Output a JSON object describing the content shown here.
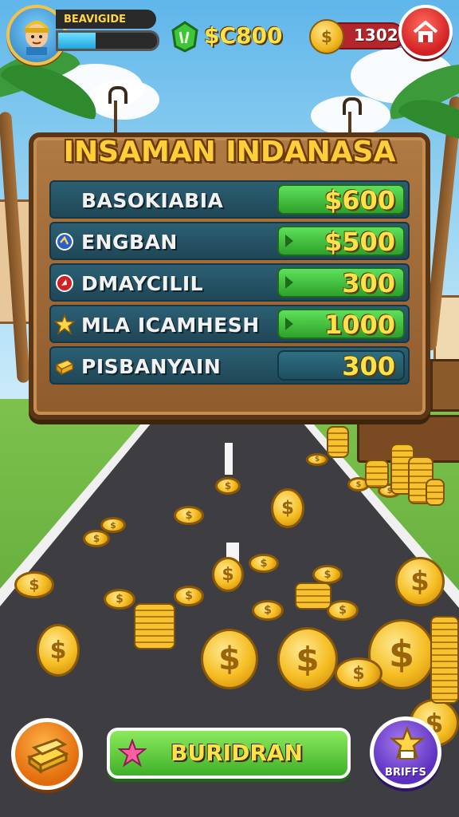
{
  "hud": {
    "player_name": "BEAVIGIDE",
    "xp_progress": 0.38,
    "cash": "$C800",
    "coins": "1302",
    "avatar_icon": "player-avatar-icon",
    "home_icon": "home-icon",
    "gem_icon": "green-gem-icon"
  },
  "shop": {
    "title": "INSAMAN INDANASA",
    "items": [
      {
        "label": "BASOKIABIA",
        "price": "$600",
        "icon": "none",
        "style": "green"
      },
      {
        "label": "ENGBAN",
        "price": "$500",
        "icon": "blue-emblem-icon",
        "style": "green"
      },
      {
        "label": "DMAYCILIL",
        "price": "300",
        "icon": "red-emblem-icon",
        "style": "green"
      },
      {
        "label": "MLA ICAMHESH",
        "price": "1000",
        "icon": "star-icon",
        "style": "green"
      },
      {
        "label": "PISBANYAIN",
        "price": "300",
        "icon": "gold-bar-icon",
        "style": "dark"
      }
    ]
  },
  "bottom": {
    "main_button": "BURIDRAN",
    "right_button": "BRIFFS",
    "left_icon": "gold-bar-icon",
    "right_icon": "star-trophy-icon"
  },
  "colors": {
    "accent_gold": "#ffe14a",
    "price_green": "#3fb02a",
    "home_red": "#d11f22",
    "board_wood": "#8f5b2c"
  }
}
